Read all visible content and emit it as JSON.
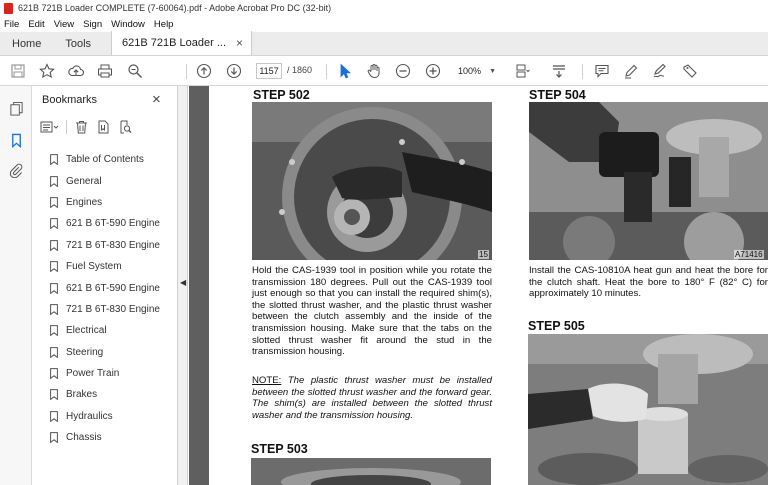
{
  "window": {
    "title": "621B 721B Loader COMPLETE (7-60064).pdf - Adobe Acrobat Pro DC (32-bit)"
  },
  "menu": [
    "File",
    "Edit",
    "View",
    "Sign",
    "Window",
    "Help"
  ],
  "tabs": {
    "home": "Home",
    "tools": "Tools",
    "document": "621B 721B Loader ...",
    "close": "×"
  },
  "toolbar": {
    "page_current": "1157",
    "page_total": "/ 1860",
    "zoom": "100%"
  },
  "bookmarks": {
    "header": "Bookmarks",
    "close": "×",
    "items": [
      "Table of Contents",
      "General",
      "Engines",
      "621 B 6T-590 Engine",
      "721 B 6T-830 Engine",
      "Fuel System",
      "621 B 6T-590 Engine",
      "721 B 6T-830 Engine",
      "Electrical",
      "Steering",
      "Power Train",
      "Brakes",
      "Hydraulics",
      "Chassis"
    ]
  },
  "document": {
    "step502": {
      "title": "STEP 502",
      "fig": "15",
      "body": "Hold the CAS-1939 tool in position while you rotate the transmission 180 degrees. Pull out the CAS-1939 tool just enough so that you can install the required shim(s), the slotted thrust washer, and the plastic thrust washer between the clutch assembly and the inside of the transmission housing. Make sure that the tabs on the slotted thrust washer fit around the stud in the transmission housing.",
      "note_label": "NOTE:",
      "note": "The plastic thrust washer must be installed between the slotted thrust washer and the forward gear. The shim(s) are installed between the slotted thrust washer and the transmission housing."
    },
    "step503": {
      "title": "STEP 503"
    },
    "step504": {
      "title": "STEP 504",
      "fig": "A71416",
      "body": "Install the CAS-10810A heat gun and heat the bore for the clutch shaft. Heat the bore to 180° F (82° C) for approximately 10 minutes."
    },
    "step505": {
      "title": "STEP 505"
    }
  }
}
